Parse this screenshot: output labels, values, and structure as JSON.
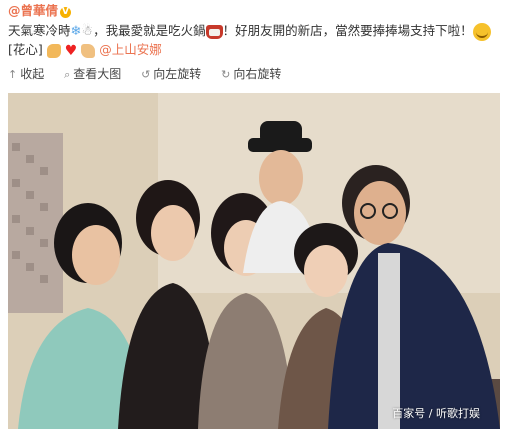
{
  "post": {
    "author": "@曾華倩",
    "text_part1": "天氣寒冷時",
    "text_part2": "，我最愛就是吃火鍋",
    "text_part3": "！好朋友開的新店，當然要捧捧場支持下啦！",
    "tag": "[花心]",
    "mention": "@上山安娜"
  },
  "toolbar": {
    "collapse_label": "收起",
    "view_large_label": "查看大图",
    "rotate_left_label": "向左旋转",
    "rotate_right_label": "向右旋转"
  },
  "photo": {
    "watermark": "百家号 / 听歌打娱"
  },
  "icons": [
    "verified-badge-icon",
    "snowflake-icon",
    "snowman-icon",
    "hotpot-icon",
    "crying-face-icon",
    "muscle-icon",
    "heart-icon",
    "clap-icon",
    "collapse-icon",
    "magnifier-icon",
    "rotate-left-icon",
    "rotate-right-icon"
  ],
  "colors": {
    "author": "#eb7350",
    "mention": "#eb7350"
  }
}
